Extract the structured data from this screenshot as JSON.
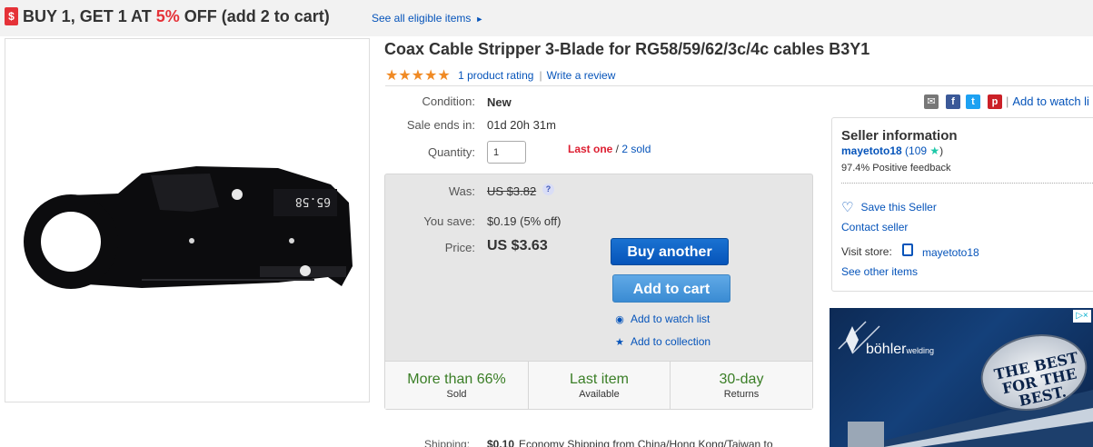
{
  "promo": {
    "tag_icon": "dollar-tag-icon",
    "text_pre": "BUY 1, GET 1 AT ",
    "text_pct": "5%",
    "text_post": " OFF (add 2 to cart)",
    "link_label": "See all eligible items",
    "link_arrow": "►"
  },
  "product": {
    "title": "Coax Cable Stripper 3-Blade for RG58/59/62/3c/4c cables B3Y1",
    "stars": "★★★★★",
    "rating_count": "1 product rating",
    "rating_sep": "|",
    "write_review": "Write a review",
    "image_label": "65.58"
  },
  "details": {
    "condition_label": "Condition:",
    "condition_value": "New",
    "sale_label": "Sale ends in:",
    "sale_value": "01d 20h 31m",
    "quantity_label": "Quantity:",
    "quantity_value": "1",
    "last_one": "Last one",
    "stock_sep": " / ",
    "sold": "2 sold"
  },
  "pricing": {
    "was_label": "Was:",
    "was_value": "US $3.82",
    "help_icon": "?",
    "save_label": "You save:",
    "save_value": "$0.19 (5% off)",
    "price_label": "Price:",
    "price_value": "US $3.63",
    "buy_label": "Buy another",
    "cart_label": "Add to cart",
    "watch_label": "Add to watch list",
    "collection_label": "Add to collection"
  },
  "stats": [
    {
      "big": "More than 66%",
      "small": "Sold"
    },
    {
      "big": "Last item",
      "small": "Available"
    },
    {
      "big": "30-day",
      "small": "Returns"
    }
  ],
  "shipping": {
    "label": "Shipping:",
    "price": "$0.10",
    "text": "Economy Shipping from China/Hong Kong/Taiwan to"
  },
  "share": {
    "watch_label": "Add to watch li",
    "sep": "|"
  },
  "seller": {
    "title": "Seller information",
    "name": "mayetoto18",
    "count": " (109 ",
    "star": "★",
    "close_paren": ")",
    "feedback": "97.4% Positive feedback",
    "save_label": "Save this Seller",
    "contact_label": "Contact seller",
    "visit_label": "Visit store:",
    "store_name": "mayetoto18",
    "other_items": "See other items"
  },
  "ad": {
    "brand": "böhler",
    "brand_small": "welding",
    "badge": "THE BEST FOR THE BEST.",
    "close": "▷×"
  },
  "colors": {
    "link": "#0654ba",
    "promo_red": "#e53238",
    "star_orange": "#f08a24",
    "stat_green": "#3a7e26",
    "buy_blue": "#0654ba",
    "cart_blue": "#3a8bd3"
  }
}
